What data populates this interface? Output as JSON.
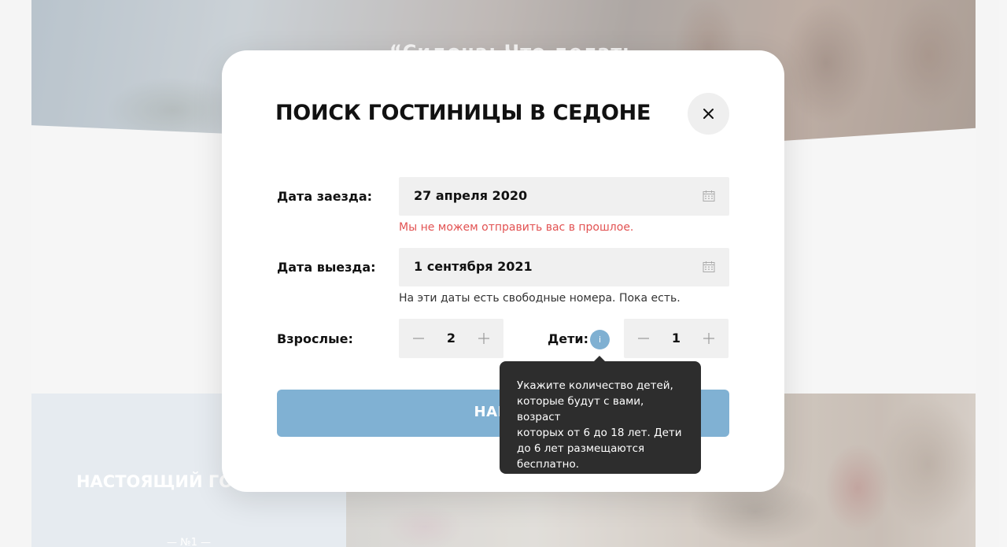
{
  "background": {
    "hero_title": "“Сидона: Что делать",
    "lower_title": "НАСТОЯЩИЙ ГОРОДОК",
    "lower_sub": "— №1 —"
  },
  "modal": {
    "title": "ПОИСК ГОСТИНИЦЫ В СЕДОНЕ",
    "close_icon": "close-icon",
    "checkin": {
      "label": "Дата заезда:",
      "value": "27 апреля 2020",
      "hint": "Мы не можем отправить вас в прошлое.",
      "hint_color": "#e25252",
      "icon": "calendar-icon"
    },
    "checkout": {
      "label": "Дата выезда:",
      "value": "1 сентября 2021",
      "hint": "На эти даты есть свободные номера. Пока есть.",
      "icon": "calendar-icon"
    },
    "adults": {
      "label": "Взрослые:",
      "value": "2"
    },
    "children": {
      "label": "Дети:",
      "value": "1",
      "info_glyph": "i"
    },
    "submit_label": "НАЙТИ",
    "accent_color": "#80b1d3"
  },
  "tooltip": {
    "line1": "Укажите количество детей,",
    "line2": "которые будут с вами, возраст",
    "line3": "которых от 6 до 18 лет. Дети",
    "line4": "до 6 лет размещаются",
    "line5": "бесплатно."
  }
}
